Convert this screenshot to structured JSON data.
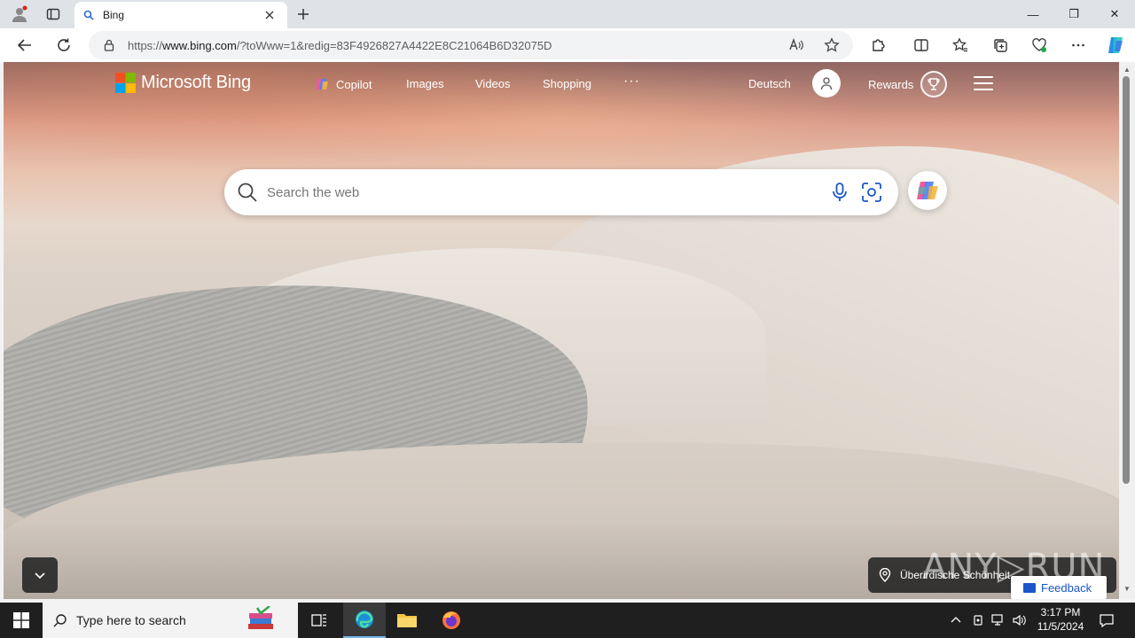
{
  "browser": {
    "tab_title": "Bing",
    "url_prefix": "https://",
    "url_host": "www.bing.com",
    "url_rest": "/?toWww=1&redig=83F4926827A4422E8C21064B6D32075D",
    "window_controls": {
      "minimize": "—",
      "restore": "❐",
      "close": "✕"
    }
  },
  "bing": {
    "logo_text": "Microsoft Bing",
    "nav": [
      {
        "label": "Copilot"
      },
      {
        "label": "Images"
      },
      {
        "label": "Videos"
      },
      {
        "label": "Shopping"
      },
      {
        "label": "···"
      }
    ],
    "language": "Deutsch",
    "rewards_label": "Rewards",
    "search_placeholder": "Search the web",
    "image_title": "Überirdische Schönheit",
    "watermark": "ANY▷RUN",
    "feedback": "Feedback",
    "ms_colors": [
      "#f25022",
      "#7fba00",
      "#00a4ef",
      "#ffb900"
    ]
  },
  "taskbar": {
    "search_placeholder": "Type here to search",
    "time": "3:17 PM",
    "date": "11/5/2024"
  }
}
